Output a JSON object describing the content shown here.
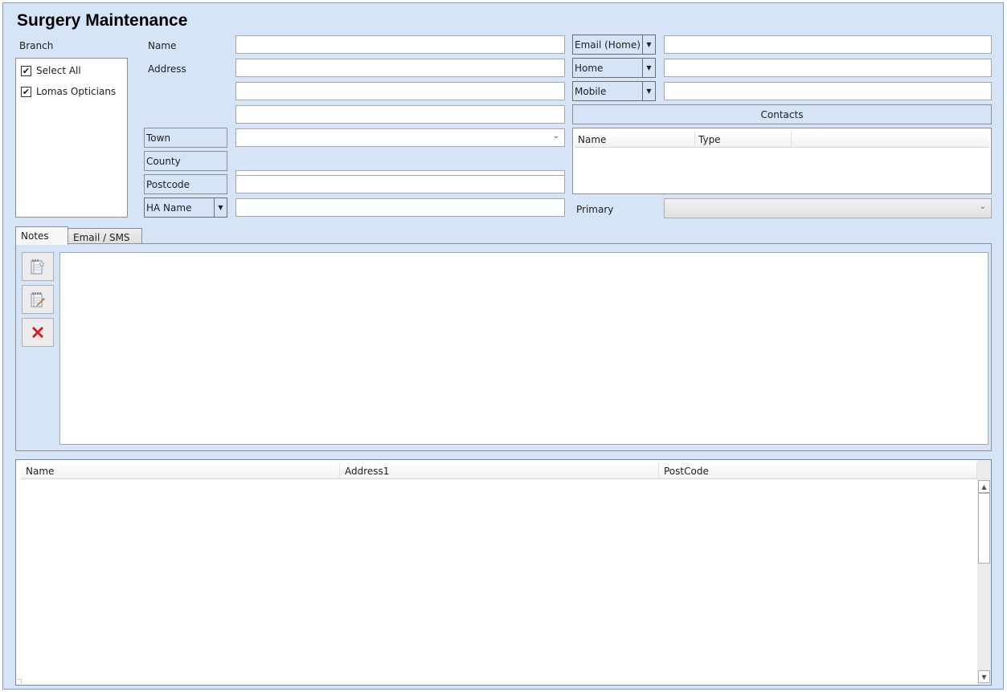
{
  "page": {
    "title": "Surgery Maintenance"
  },
  "branch": {
    "label": "Branch",
    "items": [
      {
        "label": "Select All",
        "checked": true,
        "check_glyph": "✔"
      },
      {
        "label": "Lomas Opticians",
        "checked": true,
        "check_glyph": "✔"
      }
    ]
  },
  "form": {
    "name_label": "Name",
    "name_value": "",
    "address_label": "Address",
    "address_lines": [
      "",
      "",
      ""
    ],
    "town_label": "Town",
    "town_value": "",
    "county_label": "County",
    "county_value": "",
    "postcode_label": "Postcode",
    "postcode_value": "",
    "ha_name_label": "HA Name",
    "ha_name_value": "",
    "chevron_glyph": "⌄",
    "dropdown_glyph": "▼"
  },
  "contact_methods": [
    {
      "type": "Email (Home)",
      "value": ""
    },
    {
      "type": "Home",
      "value": ""
    },
    {
      "type": "Mobile",
      "value": ""
    }
  ],
  "contacts": {
    "button_label": "Contacts",
    "columns": [
      "Name",
      "Type"
    ],
    "rows": [],
    "primary_label": "Primary",
    "primary_value": ""
  },
  "tabs": [
    {
      "label": "Notes",
      "active": true
    },
    {
      "label": "Email / SMS",
      "active": false
    }
  ],
  "notes": {
    "toolbar": [
      {
        "name": "new-note",
        "icon": "new-note-icon"
      },
      {
        "name": "edit-note",
        "icon": "edit-note-icon"
      },
      {
        "name": "delete-note",
        "icon": "delete-icon",
        "glyph": "✕"
      }
    ],
    "text": ""
  },
  "results": {
    "columns": [
      "Name",
      "Address1",
      "PostCode"
    ],
    "rows": [],
    "scroll_up_glyph": "▲",
    "scroll_down_glyph": "▼"
  },
  "colors": {
    "background": "#d6e4f7",
    "border_accent": "#7a9fd3",
    "delete_red": "#d7191c"
  }
}
